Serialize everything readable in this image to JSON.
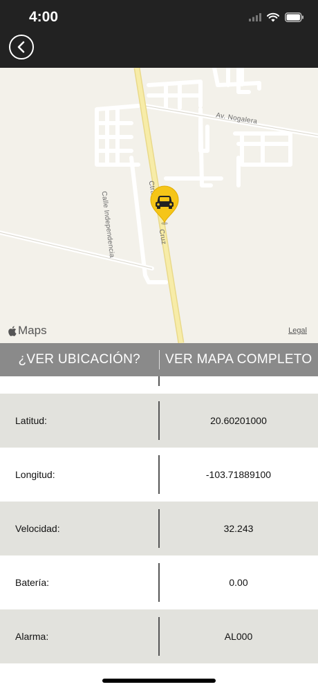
{
  "status_bar": {
    "time": "4:00"
  },
  "nav": {
    "back_icon": "chevron-left-circle-icon"
  },
  "map": {
    "labels": {
      "nogalera": "Av. Nogalera",
      "independencia": "Calle Independencia",
      "carretera_top": "Ctra",
      "carretera_bottom": "Cruz"
    },
    "attribution": {
      "brand": "Maps",
      "legal": "Legal"
    },
    "marker_icon": "car-pin-icon",
    "marker_color": "#f5c518"
  },
  "actions": {
    "view_location": "¿VER UBICACIÓN?",
    "view_full_map": "VER MAPA COMPLETO"
  },
  "details": [
    {
      "label": "Latitud:",
      "value": "20.60201000"
    },
    {
      "label": "Longitud:",
      "value": "-103.71889100"
    },
    {
      "label": "Velocidad:",
      "value": "32.243"
    },
    {
      "label": "Batería:",
      "value": "0.00"
    },
    {
      "label": "Alarma:",
      "value": "AL000"
    }
  ],
  "colors": {
    "topbar": "#222222",
    "actionbar": "#8a8a8a",
    "row_shade": "#e2e2dd",
    "map_bg": "#f3f1ea"
  }
}
